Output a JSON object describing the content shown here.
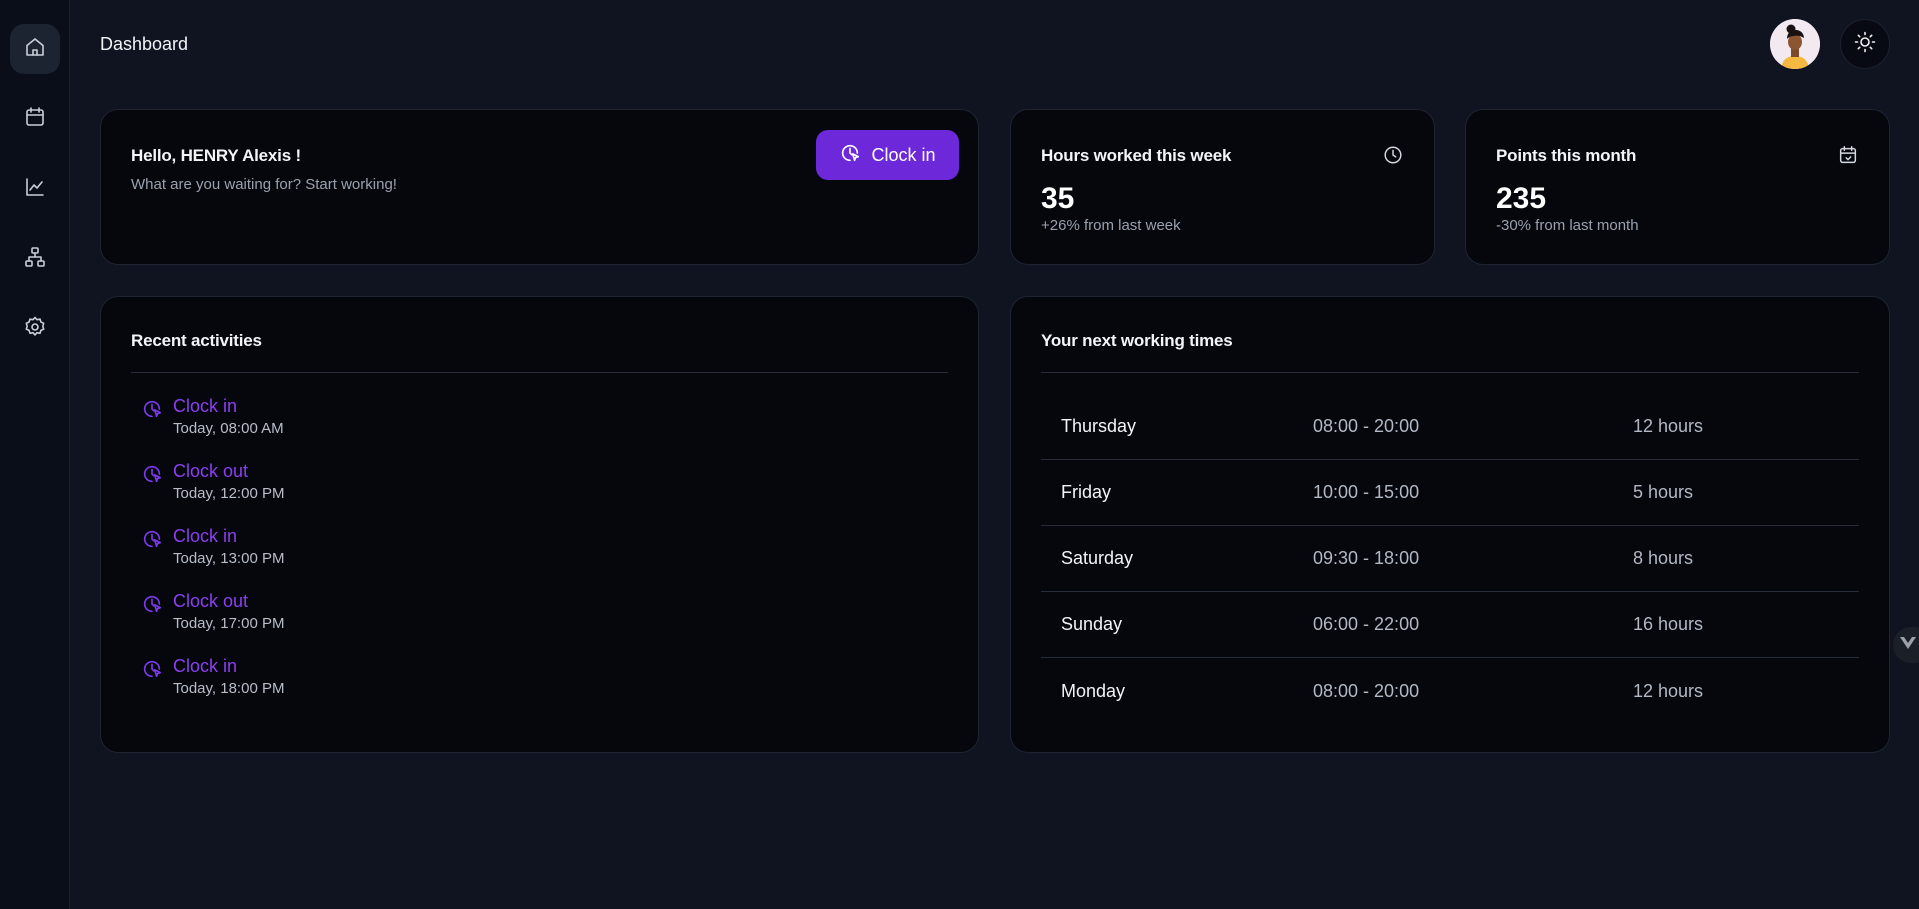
{
  "sidebar": {
    "items": [
      {
        "name": "home",
        "icon": "home-icon",
        "active": true
      },
      {
        "name": "calendar",
        "icon": "calendar-icon",
        "active": false
      },
      {
        "name": "stats",
        "icon": "chart-line-icon",
        "active": false
      },
      {
        "name": "teams",
        "icon": "org-chart-icon",
        "active": false
      },
      {
        "name": "settings",
        "icon": "gear-icon",
        "active": false
      }
    ]
  },
  "header": {
    "title": "Dashboard",
    "avatar_icon": "user-avatar",
    "theme_icon": "sun-icon"
  },
  "hello": {
    "greeting": "Hello, HENRY Alexis !",
    "subtitle": "What are you waiting for? Start working!",
    "clock_in_label": "Clock in"
  },
  "hours": {
    "title": "Hours worked this week",
    "value": "35",
    "change": "+26% from last week",
    "icon": "clock-icon"
  },
  "points": {
    "title": "Points this month",
    "value": "235",
    "change": "-30% from last month",
    "icon": "calendar-check-icon"
  },
  "activities": {
    "title": "Recent activities",
    "items": [
      {
        "label": "Clock in",
        "time": "Today, 08:00 AM"
      },
      {
        "label": "Clock out",
        "time": "Today, 12:00 PM"
      },
      {
        "label": "Clock in",
        "time": "Today, 13:00 PM"
      },
      {
        "label": "Clock out",
        "time": "Today, 17:00 PM"
      },
      {
        "label": "Clock in",
        "time": "Today, 18:00 PM"
      }
    ]
  },
  "schedule": {
    "title": "Your next working times",
    "rows": [
      {
        "day": "Thursday",
        "range": "08:00 - 20:00",
        "hours": "12 hours"
      },
      {
        "day": "Friday",
        "range": "10:00 - 15:00",
        "hours": "5 hours"
      },
      {
        "day": "Saturday",
        "range": "09:30 - 18:00",
        "hours": "8 hours"
      },
      {
        "day": "Sunday",
        "range": "06:00 - 22:00",
        "hours": "16 hours"
      },
      {
        "day": "Monday",
        "range": "08:00 - 20:00",
        "hours": "12 hours"
      }
    ]
  },
  "colors": {
    "accent": "#6d28d9",
    "activity": "#8b3ff0",
    "background": "#0f1420",
    "card": "#05070d"
  }
}
